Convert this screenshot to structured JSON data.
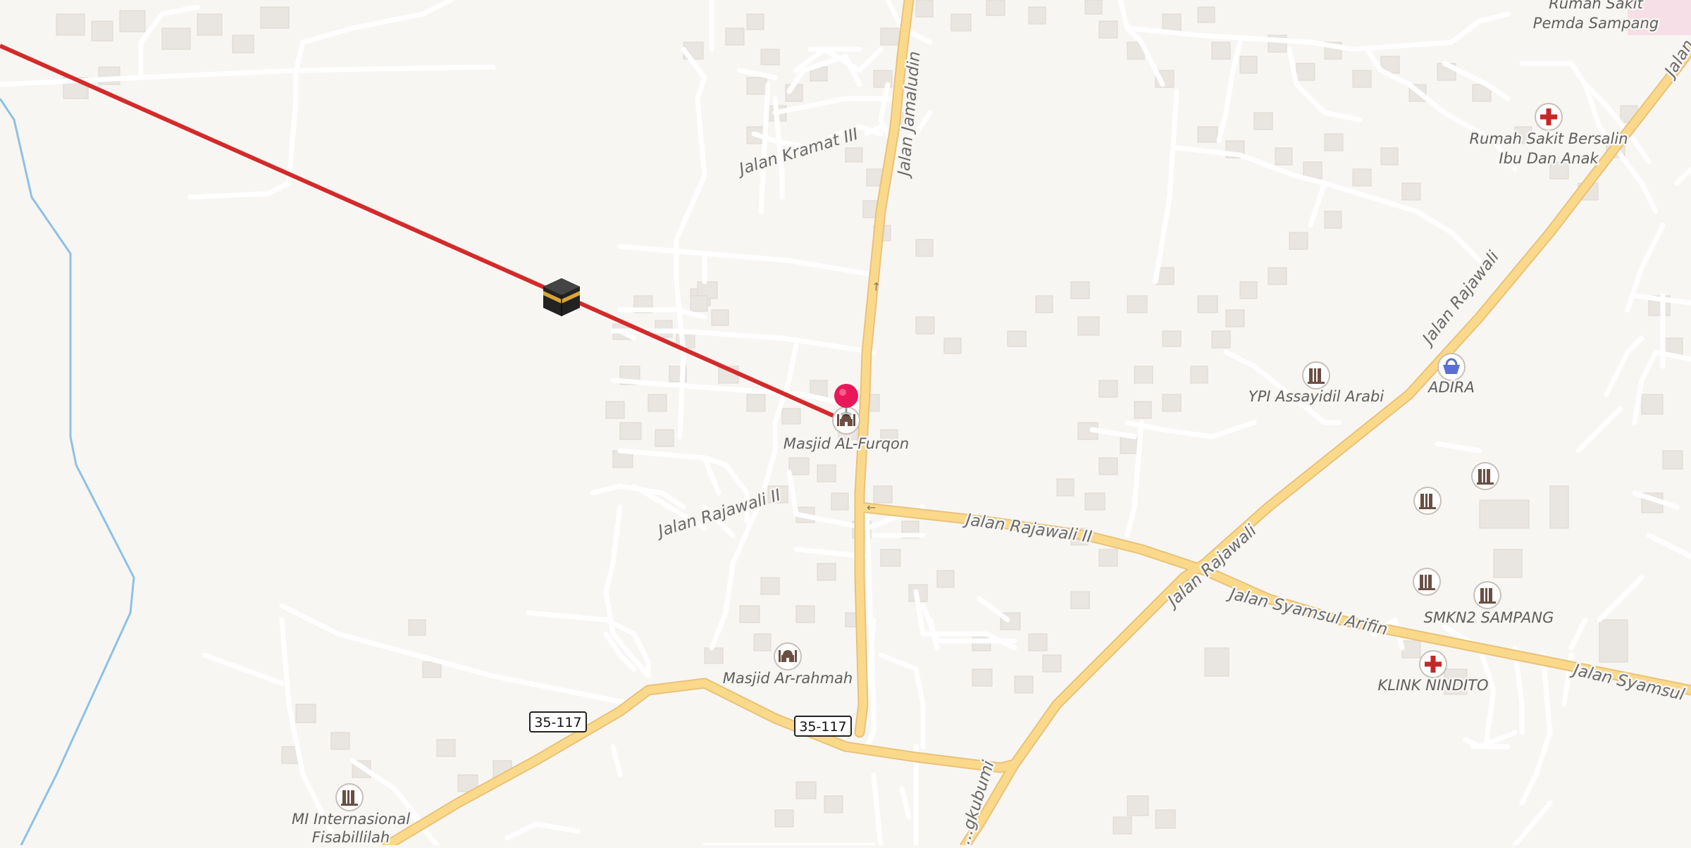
{
  "map": {
    "roads": [
      {
        "name": "Jalan Jamaludin"
      },
      {
        "name": "Jalan Kramat III"
      },
      {
        "name": "Jalan Rajawali II"
      },
      {
        "name": "Jalan Rajawali II"
      },
      {
        "name": "Jalan Rajawali"
      },
      {
        "name": "Jalan Rajawali"
      },
      {
        "name": "Jalan Syamsul Arifin"
      },
      {
        "name": "Jalan Syamsul"
      },
      {
        "name": "Jalan"
      },
      {
        "name": "...gkubumi"
      }
    ],
    "route_shields": [
      "35-117",
      "35-117"
    ],
    "pois": [
      {
        "name": "Masjid AL-Furqon",
        "icon": "mosque-icon"
      },
      {
        "name": "Masjid Ar-rahmah",
        "icon": "mosque-icon"
      },
      {
        "name": "MI Internasional",
        "name2": "Fisabillilah",
        "icon": "school-icon"
      },
      {
        "name": "YPI Assayidil Arabi",
        "icon": "school-icon"
      },
      {
        "name": "ADIRA",
        "icon": "shop-basket-icon"
      },
      {
        "name": "Rumah Sakit Bersalin",
        "name2": "Ibu Dan Anak",
        "icon": "hospital-icon"
      },
      {
        "name": "Rumah Sakit",
        "name2": "Pemda Sampang",
        "icon": "hospital-icon"
      },
      {
        "name": "SMKN2 SAMPANG",
        "icon": "school-icon"
      },
      {
        "name": "KLINK NINDITO",
        "icon": "hospital-icon"
      }
    ],
    "qibla": {
      "marker_icon": "kaaba-icon",
      "line_color": "#d42a2a"
    },
    "location_pin_color": "#e8185a",
    "colors": {
      "background": "#f8f6f3",
      "minor_road": "#ffffff",
      "major_road": "#fbd98a",
      "major_road_casing": "#e9c27a",
      "river": "#8ec1e6",
      "building": "#e9e5e0",
      "hospital": "#c62828",
      "poi_icon": "#6b4f44"
    }
  }
}
